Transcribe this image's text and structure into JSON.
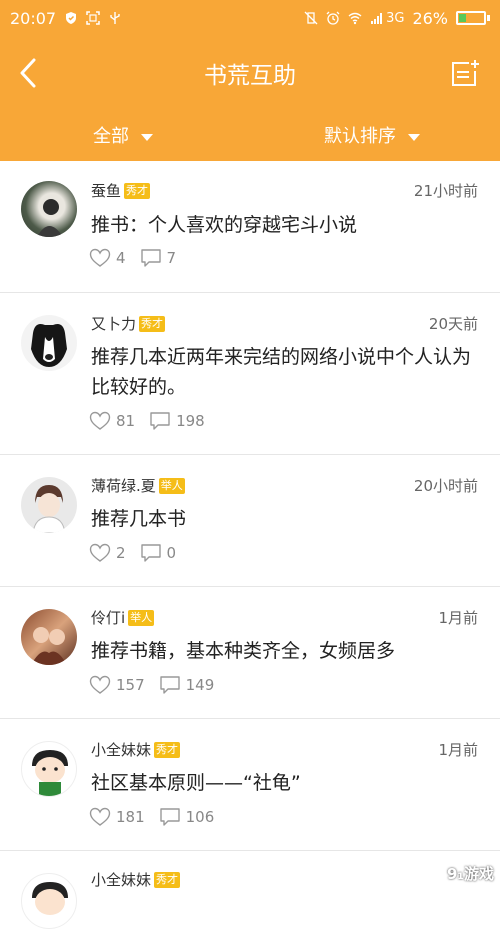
{
  "status_bar": {
    "time": "20:07",
    "network": "3G",
    "battery": "26%",
    "battery_level": 0.26
  },
  "header": {
    "title": "书荒互助"
  },
  "filters": {
    "category": "全部",
    "sort": "默认排序"
  },
  "posts": [
    {
      "user": "蚕鱼",
      "badge": "秀才",
      "time": "21小时前",
      "title": "推书：个人喜欢的穿越宅斗小说",
      "likes": "4",
      "comments": "7"
    },
    {
      "user": "又卜力",
      "badge": "秀才",
      "time": "20天前",
      "title": "推荐几本近两年来完结的网络小说中个人认为比较好的。",
      "likes": "81",
      "comments": "198"
    },
    {
      "user": "薄荷绿.夏",
      "badge": "举人",
      "time": "20小时前",
      "title": "推荐几本书",
      "likes": "2",
      "comments": "0"
    },
    {
      "user": "伶仃i",
      "badge": "举人",
      "time": "1月前",
      "title": "推荐书籍，基本种类齐全，女频居多",
      "likes": "157",
      "comments": "149"
    },
    {
      "user": "小全妹妹",
      "badge": "秀才",
      "time": "1月前",
      "title": "社区基本原则——“社龟”",
      "likes": "181",
      "comments": "106"
    },
    {
      "user": "小全妹妹",
      "badge": "秀才"
    }
  ],
  "watermark": "9₁游戏",
  "colors": {
    "accent": "#f8a737",
    "badge": "#f5bd18"
  }
}
